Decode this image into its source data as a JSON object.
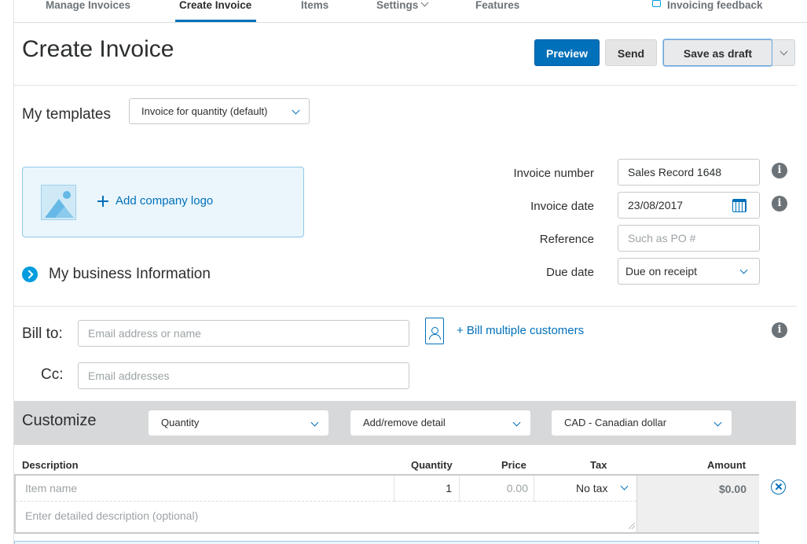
{
  "nav": {
    "manage_invoices": "Manage Invoices",
    "create_invoice": "Create Invoice",
    "items": "Items",
    "settings": "Settings",
    "features": "Features",
    "feedback": "Invoicing feedback"
  },
  "header": {
    "title": "Create Invoice",
    "preview_label": "Preview",
    "send_label": "Send",
    "draft_label": "Save as draft"
  },
  "templates": {
    "label": "My templates",
    "selected": "Invoice for quantity (default)"
  },
  "logo": {
    "add_label": "Add company logo"
  },
  "business": {
    "label": "My business Information"
  },
  "invoice_fields": {
    "number_label": "Invoice number",
    "number_value": "Sales Record 1648",
    "date_label": "Invoice date",
    "date_value": "23/08/2017",
    "reference_label": "Reference",
    "reference_placeholder": "Such as PO #",
    "due_label": "Due date",
    "due_value": "Due on receipt"
  },
  "bill": {
    "bill_to_label": "Bill to:",
    "bill_to_placeholder": "Email address or name",
    "cc_label": "Cc:",
    "cc_placeholder": "Email addresses",
    "multi_link": "+ Bill multiple customers"
  },
  "customize": {
    "label": "Customize",
    "quantity_select": "Quantity",
    "detail_select": "Add/remove detail",
    "currency_select": "CAD - Canadian dollar"
  },
  "line_items": {
    "headers": {
      "description": "Description",
      "quantity": "Quantity",
      "price": "Price",
      "tax": "Tax",
      "amount": "Amount"
    },
    "item_placeholder": "Item name",
    "quantity_value": "1",
    "price_placeholder": "0.00",
    "tax_value": "No tax",
    "amount_value": "$0.00",
    "description_placeholder": "Enter detailed description (optional)"
  },
  "colors": {
    "primary": "#0070ba",
    "accent": "#009cde",
    "customize_bar": "#d7d8d9"
  }
}
